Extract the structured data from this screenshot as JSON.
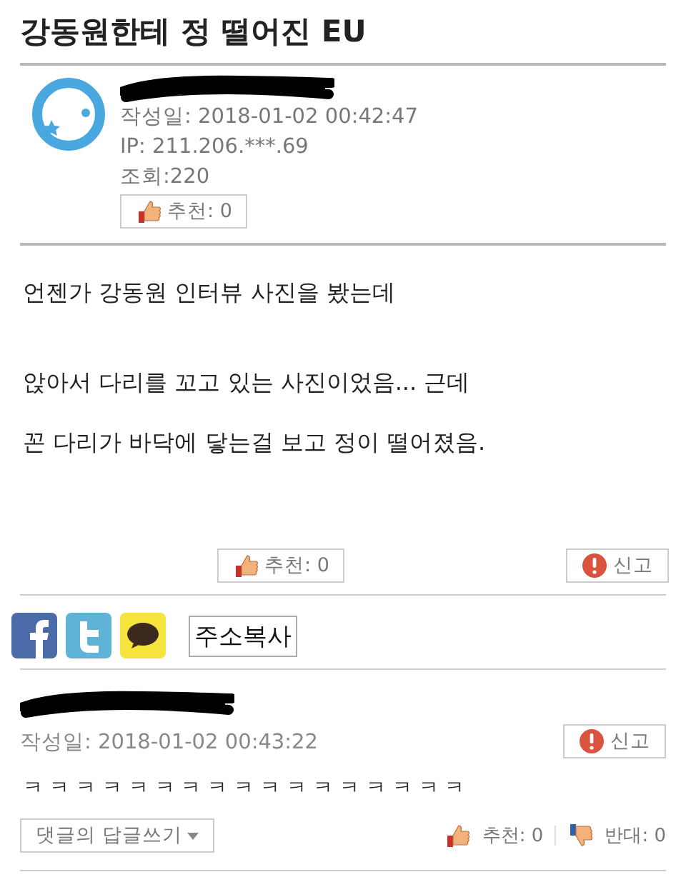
{
  "post": {
    "title": "강동원한테 정 떨어진 EU",
    "author": {
      "name_redacted": true,
      "date": "작성일: 2018-01-02 00:42:47",
      "ip": "IP: 211.206.***.69",
      "views": "조회:220",
      "recommend": "추천: 0"
    },
    "body": [
      [
        "언젠가 강동원 인터뷰 사진을 봤는데"
      ],
      [
        "앉아서 다리를 꼬고 있는 사진이었음... 근데",
        "꼰 다리가 바닥에 닿는걸 보고 정이 떨어졌음."
      ]
    ],
    "recommend": "추천: 0",
    "report": "신고"
  },
  "share": {
    "buttons": [
      {
        "kind": "facebook"
      },
      {
        "kind": "twitter"
      },
      {
        "kind": "kakaotalk"
      }
    ],
    "copy": "주소복사"
  },
  "comments": [
    {
      "name_redacted": true,
      "date": "작성일: 2018-01-02 00:43:22",
      "report": "신고",
      "text": "ㅋ ㅋ ㅋ ㅋ ㅋ ㅋ ㅋ ㅋ ㅋ ㅋ ㅋ ㅋ ㅋ ㅋ ㅋ ㅋ ㅋ",
      "reply": "댓글의 답글쓰기",
      "up": "추천: 0",
      "down": "반대: 0"
    }
  ]
}
